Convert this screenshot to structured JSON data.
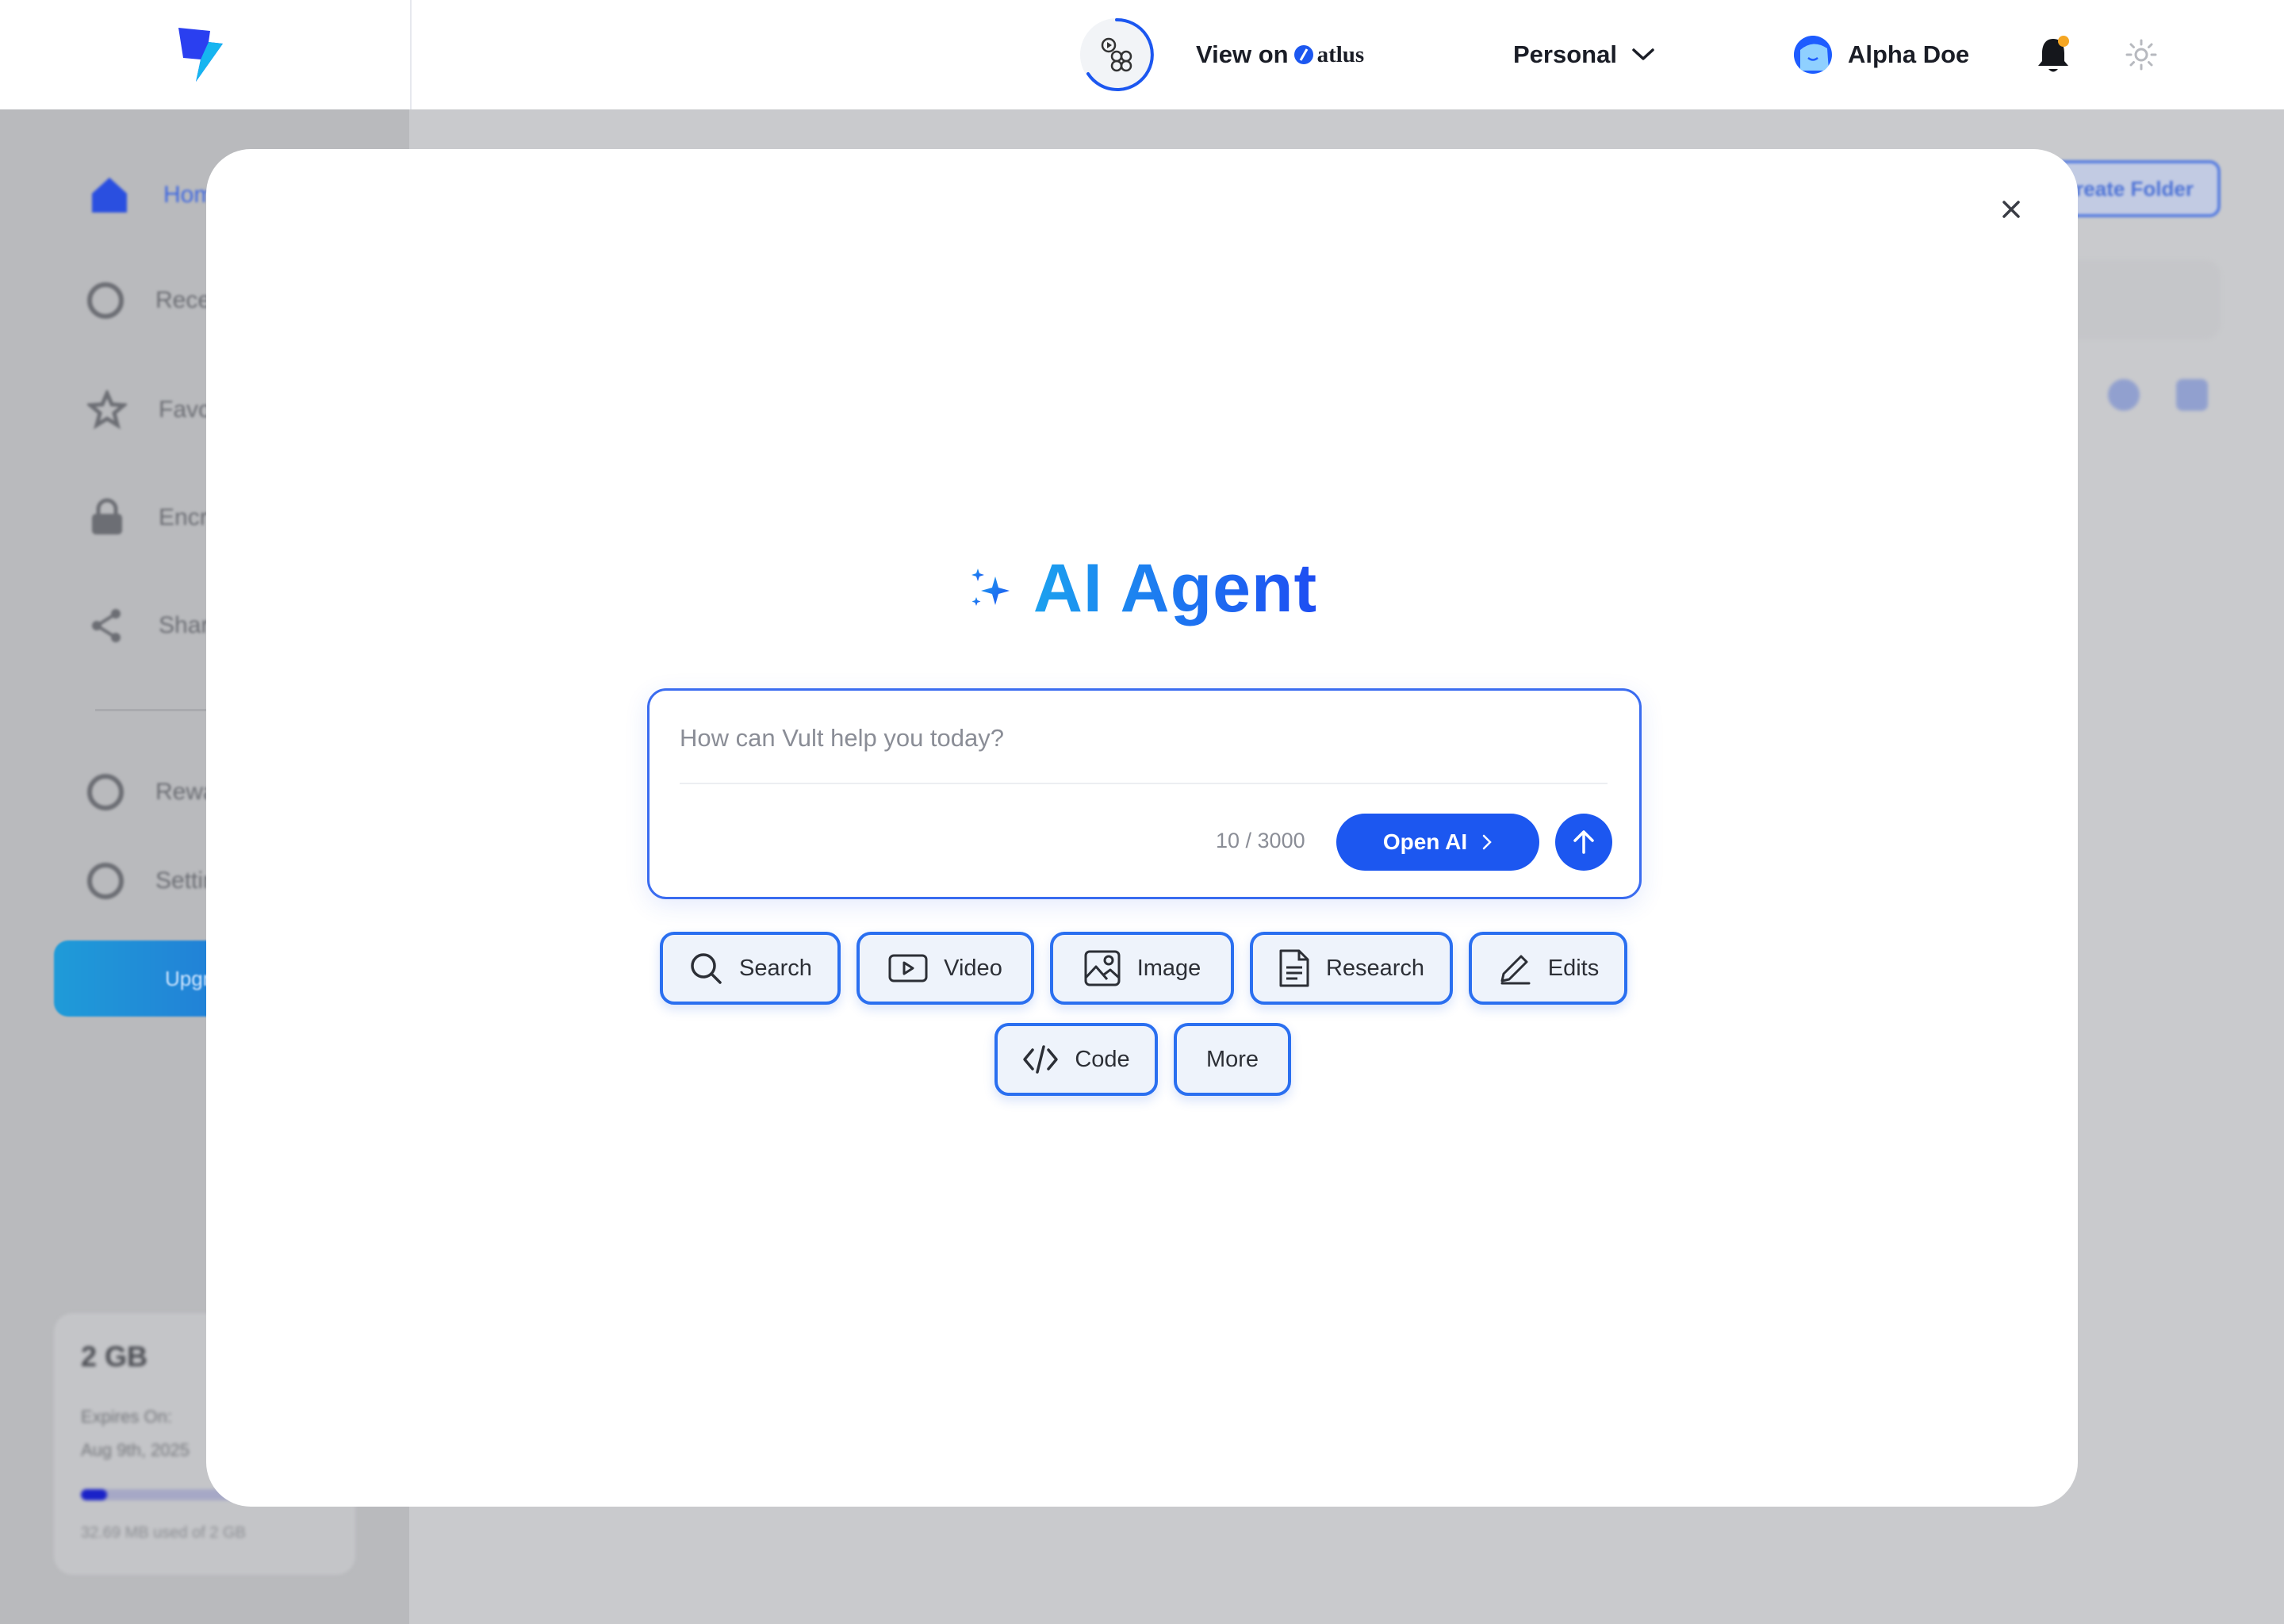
{
  "topbar": {
    "view_on_label": "View on",
    "view_on_brand": "atlus",
    "workspace": "Personal",
    "user_name": "Alpha Doe"
  },
  "background": {
    "sidebar_items": [
      "Home",
      "Recent",
      "Favorites",
      "Encrypted",
      "Shared",
      "Rewards",
      "Settings"
    ],
    "upgrade_label": "Upgrade",
    "storage": {
      "amount": "2 GB",
      "expires_label": "Expires On:",
      "expires_date": "Aug 9th, 2025",
      "usage": "32.69 MB used of 2 GB",
      "used_fraction": 0.11
    },
    "create_folder_label": "Create Folder"
  },
  "modal": {
    "title": "AI Agent",
    "prompt": {
      "value": "",
      "placeholder": "How can Vult help you today?",
      "counter": "10 / 3000",
      "model_label": "Open AI"
    },
    "chips": [
      {
        "label": "Search",
        "icon": "search-icon"
      },
      {
        "label": "Video",
        "icon": "video-icon"
      },
      {
        "label": "Image",
        "icon": "image-icon"
      },
      {
        "label": "Research",
        "icon": "document-icon"
      },
      {
        "label": "Edits",
        "icon": "pencil-icon"
      },
      {
        "label": "Code",
        "icon": "code-icon"
      },
      {
        "label": "More",
        "icon": ""
      }
    ]
  },
  "colors": {
    "accent": "#1c57f0",
    "title_gradient_start": "#1ca1ef",
    "title_gradient_end": "#1e4df2",
    "chip_border": "#2a6ff0",
    "notification_dot": "#f5a623"
  }
}
